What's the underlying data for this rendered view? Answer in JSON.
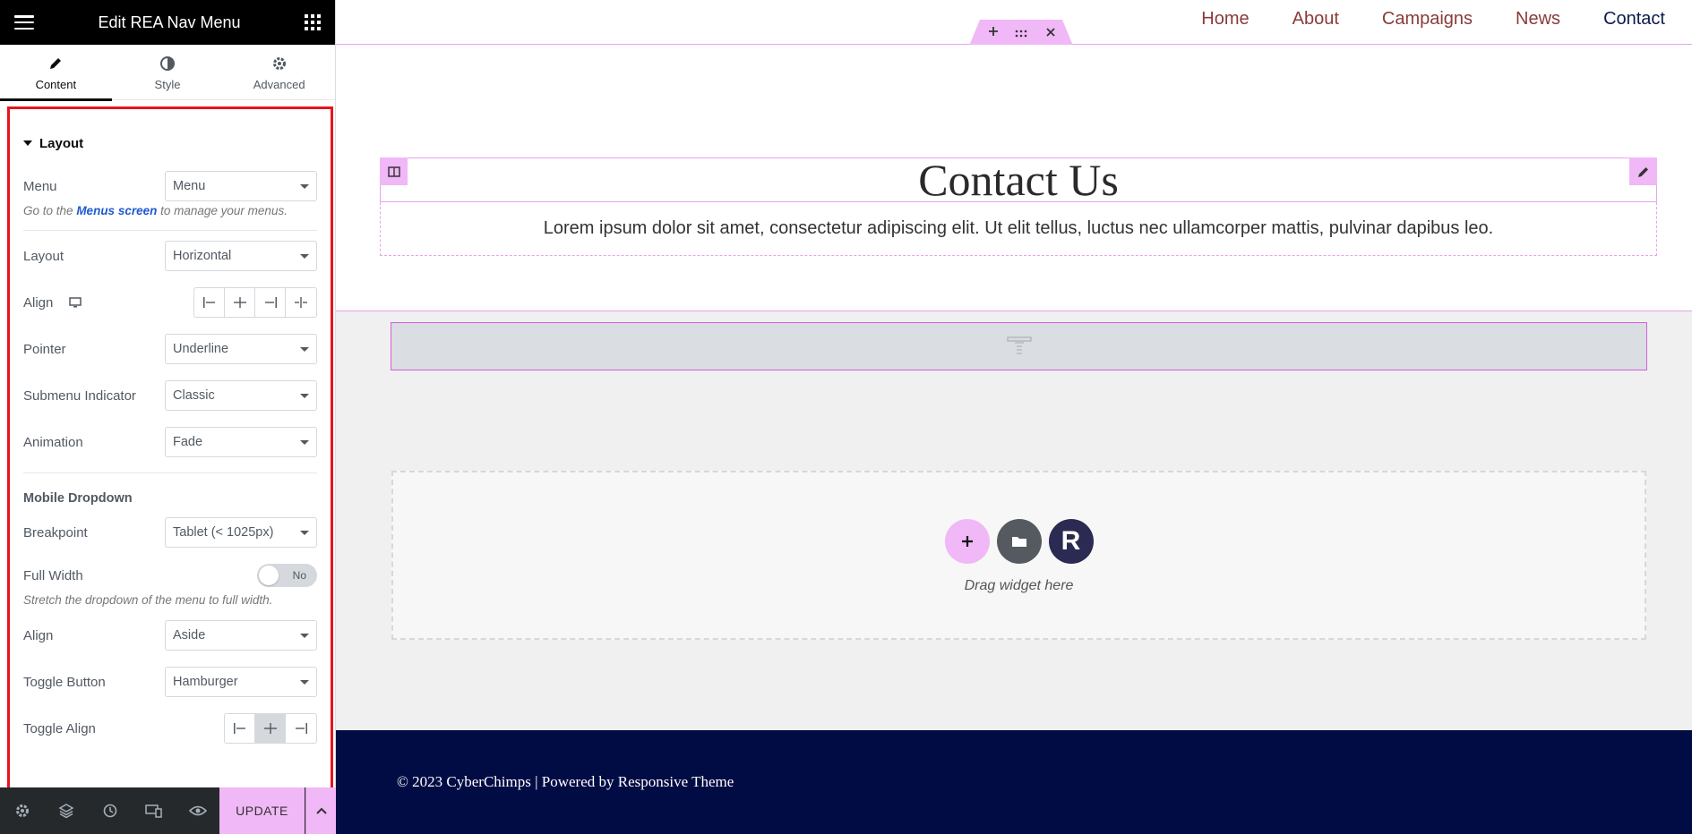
{
  "panel": {
    "title": "Edit REA Nav Menu",
    "tabs": [
      {
        "label": "Content",
        "icon": "pencil-icon",
        "active": true
      },
      {
        "label": "Style",
        "icon": "half-circle-icon",
        "active": false
      },
      {
        "label": "Advanced",
        "icon": "gear-icon",
        "active": false
      }
    ],
    "section": "Layout",
    "menu": {
      "label": "Menu",
      "value": "Menu"
    },
    "hint": {
      "prefix": "Go to the",
      "link": "Menus screen",
      "suffix": "to manage your menus."
    },
    "layout": {
      "label": "Layout",
      "value": "Horizontal"
    },
    "align": {
      "label": "Align"
    },
    "pointer": {
      "label": "Pointer",
      "value": "Underline"
    },
    "submenu_indicator": {
      "label": "Submenu Indicator",
      "value": "Classic"
    },
    "animation": {
      "label": "Animation",
      "value": "Fade"
    },
    "mobile_dropdown": "Mobile Dropdown",
    "breakpoint": {
      "label": "Breakpoint",
      "value": "Tablet (< 1025px)"
    },
    "full_width": {
      "label": "Full Width",
      "toggle": "No",
      "hint": "Stretch the dropdown of the menu to full width."
    },
    "dropdown_align": {
      "label": "Align",
      "value": "Aside"
    },
    "toggle_button": {
      "label": "Toggle Button",
      "value": "Hamburger"
    },
    "toggle_align": {
      "label": "Toggle Align",
      "selected_index": 1
    },
    "footer": {
      "update": "UPDATE"
    }
  },
  "canvas": {
    "nav": [
      "Home",
      "About",
      "Campaigns",
      "News",
      "Contact"
    ],
    "current_nav": "Contact",
    "title": "Contact Us",
    "lorem": "Lorem ipsum dolor sit amet, consectetur adipiscing elit. Ut elit tellus, luctus nec ullamcorper mattis, pulvinar dapibus leo.",
    "drop_hint": "Drag widget here",
    "dz_r": "R",
    "copyright": "© 2023 CyberChimps | Powered by Responsive Theme"
  },
  "colors": {
    "accent": "#f0b8f6",
    "panel_header": "#000000",
    "highlight_border": "#e8141c",
    "footer_bg": "#020c44",
    "nav_link": "#8a3b3b"
  }
}
